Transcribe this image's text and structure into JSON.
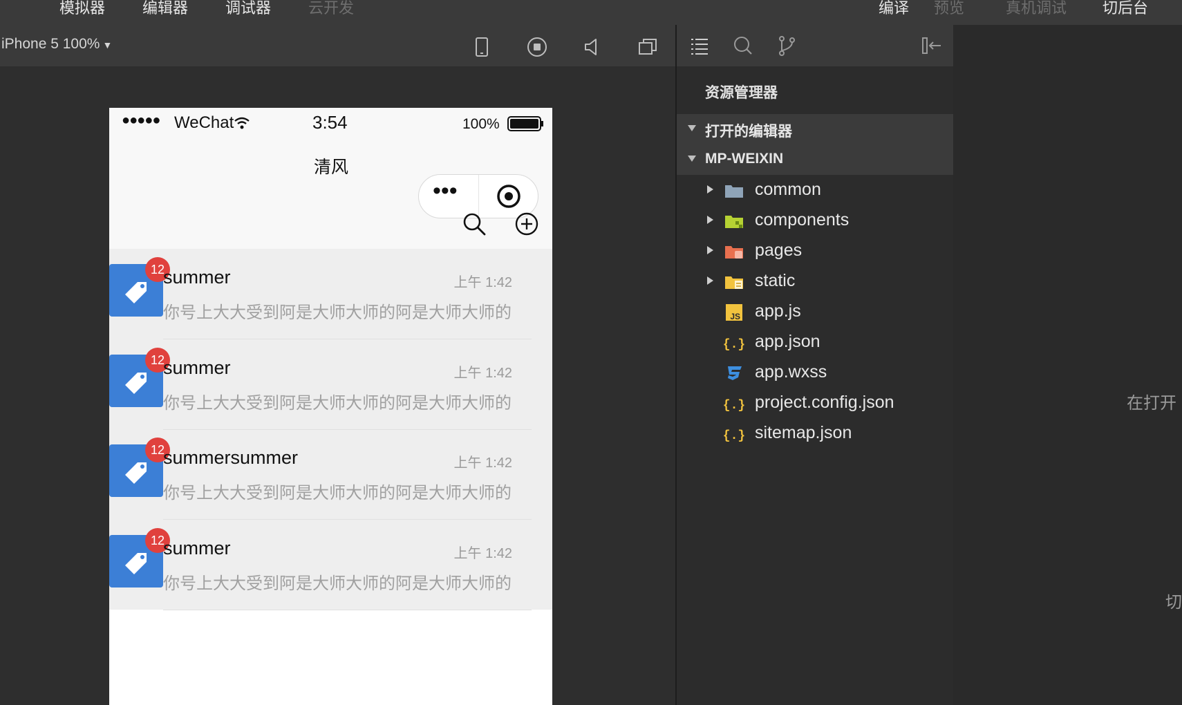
{
  "toolbar": {
    "left_items": [
      "模拟器",
      "编辑器",
      "调试器",
      "云开发"
    ],
    "right_items": [
      "编译",
      "预览",
      "真机调试",
      "切后台"
    ]
  },
  "simulator": {
    "device": "iPhone 5 100%",
    "icons": [
      "phone-icon",
      "stop-record-icon",
      "speaker-icon",
      "new-window-icon"
    ]
  },
  "phone": {
    "status": {
      "signal": "●●●●●",
      "carrier": "WeChat",
      "time": "3:54",
      "battery_percent": "100%"
    },
    "nav_title": "清风",
    "capsule": {
      "more": "•••"
    }
  },
  "chats": [
    {
      "name": "summer",
      "time": "上午 1:42",
      "badge": "12",
      "preview": "你号上大大受到阿是大师大师的阿是大师大师的"
    },
    {
      "name": "summer",
      "time": "上午 1:42",
      "badge": "12",
      "preview": "你号上大大受到阿是大师大师的阿是大师大师的"
    },
    {
      "name": "summersummer",
      "time": "上午 1:42",
      "badge": "12",
      "preview": "你号上大大受到阿是大师大师的阿是大师大师的"
    },
    {
      "name": "summer",
      "time": "上午 1:42",
      "badge": "12",
      "preview": "你号上大大受到阿是大师大师的阿是大师大师的"
    }
  ],
  "explorer": {
    "title": "资源管理器",
    "open_editors": "打开的编辑器",
    "project": "MP-WEIXIN",
    "files": [
      {
        "name": "common",
        "type": "folder",
        "icon": "folder-icon",
        "color": "#8fa4b8"
      },
      {
        "name": "components",
        "type": "folder",
        "icon": "components-folder-icon",
        "color": "#b6d233"
      },
      {
        "name": "pages",
        "type": "folder",
        "icon": "pages-folder-icon",
        "color": "#e8704f"
      },
      {
        "name": "static",
        "type": "folder",
        "icon": "static-folder-icon",
        "color": "#f2c33e"
      },
      {
        "name": "app.js",
        "type": "file",
        "icon": "js-file-icon",
        "color": "#f2c33e"
      },
      {
        "name": "app.json",
        "type": "file",
        "icon": "json-file-icon",
        "color": "#f2c33e"
      },
      {
        "name": "app.wxss",
        "type": "file",
        "icon": "css-file-icon",
        "color": "#3d8fe0"
      },
      {
        "name": "project.config.json",
        "type": "file",
        "icon": "json-file-icon",
        "color": "#f2c33e"
      },
      {
        "name": "sitemap.json",
        "type": "file",
        "icon": "json-file-icon",
        "color": "#f2c33e"
      }
    ]
  },
  "editor_hints": [
    "在打开",
    "切"
  ]
}
